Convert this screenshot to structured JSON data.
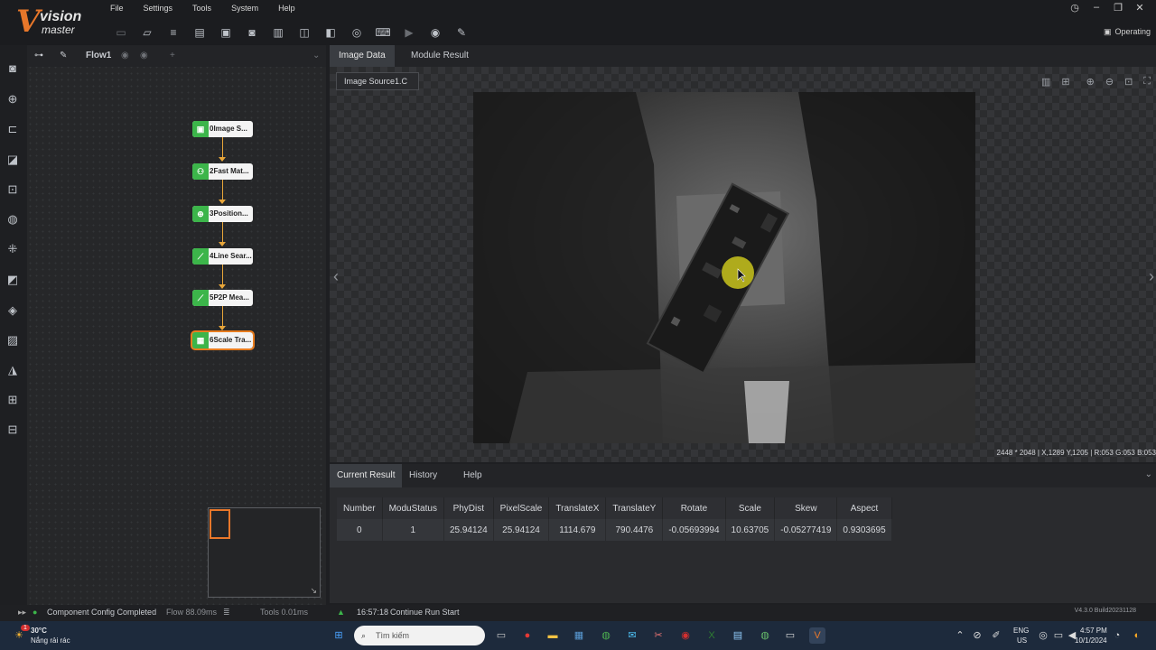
{
  "app": {
    "logo_word1": "vision",
    "logo_word2": "master",
    "menu": [
      "File",
      "Settings",
      "Tools",
      "System",
      "Help"
    ],
    "status": "Operating"
  },
  "flow": {
    "tab_label": "Flow1",
    "nodes": [
      {
        "label": "0Image S...",
        "icon": "image-icon"
      },
      {
        "label": "2Fast Mat...",
        "icon": "match-icon"
      },
      {
        "label": "3Position...",
        "icon": "position-icon"
      },
      {
        "label": "4Line Sear...",
        "icon": "line-icon"
      },
      {
        "label": "5P2P Mea...",
        "icon": "measure-icon"
      },
      {
        "label": "6Scale Tra...",
        "icon": "scale-icon"
      }
    ]
  },
  "image_panel": {
    "tabs": [
      "Image Data",
      "Module Result"
    ],
    "source": "Image Source1.C",
    "status_line": "2448 * 2048  |  X,1289  Y,1205  |  R:053  G:053  B:053"
  },
  "results": {
    "tabs": [
      "Current Result",
      "History",
      "Help"
    ],
    "columns": [
      "Number",
      "ModuStatus",
      "PhyDist",
      "PixelScale",
      "TranslateX",
      "TranslateY",
      "Rotate",
      "Scale",
      "Skew",
      "Aspect"
    ],
    "rows": [
      [
        "0",
        "1",
        "25.94124",
        "25.94124",
        "1114.679",
        "790.4476",
        "-0.05693994",
        "10.63705",
        "-0.05277419",
        "0.9303695"
      ]
    ]
  },
  "statusbar": {
    "component": "Component Config Completed",
    "flow_time": "Flow  88.09ms",
    "tools_time": "Tools  0.01ms",
    "run_time": "16:57:18",
    "run_msg": "Continue Run Start",
    "version": "V4.3.0 Build20231128"
  },
  "taskbar": {
    "temp": "30°C",
    "weather": "Nắng rải rác",
    "search_placeholder": "Tìm kiếm",
    "lang1": "ENG",
    "lang2": "US",
    "time": "4:57 PM",
    "date": "10/1/2024",
    "badge": "1"
  }
}
